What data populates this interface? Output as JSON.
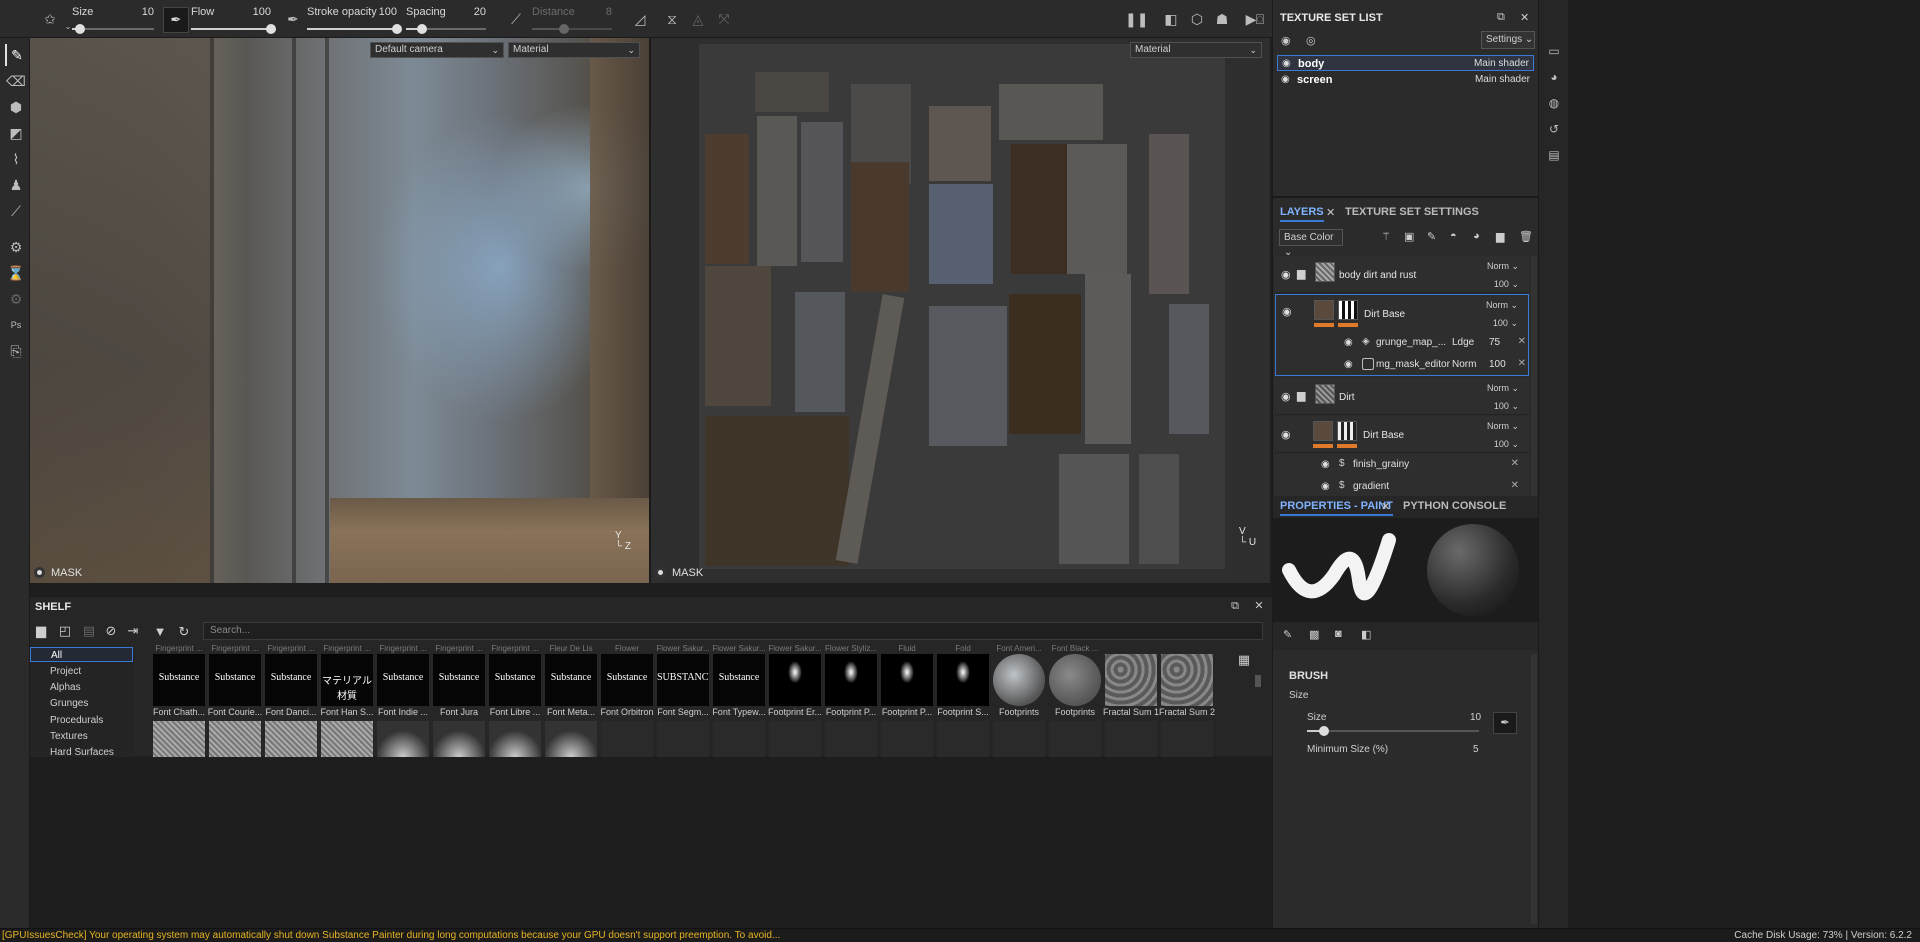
{
  "toolbar": {
    "size": {
      "label": "Size",
      "value": "10",
      "fraction": 0.1
    },
    "flow": {
      "label": "Flow",
      "value": "100",
      "fraction": 1.0
    },
    "stroke_opacity": {
      "label": "Stroke opacity",
      "value": "100",
      "fraction": 1.0
    },
    "spacing": {
      "label": "Spacing",
      "value": "20",
      "fraction": 0.2
    },
    "distance": {
      "label": "Distance",
      "value": "8",
      "fraction": 0.4
    }
  },
  "viewport_3d": {
    "camera": "Default camera",
    "channel": "Material",
    "mask_label": "MASK"
  },
  "viewport_uv": {
    "channel": "Material",
    "mask_label": "MASK"
  },
  "texture_set_list": {
    "title": "TEXTURE SET LIST",
    "settings_label": "Settings",
    "items": [
      {
        "name": "body",
        "shader": "Main shader"
      },
      {
        "name": "screen",
        "shader": "Main shader"
      }
    ]
  },
  "layers_panel": {
    "tabs": [
      "LAYERS",
      "TEXTURE SET SETTINGS"
    ],
    "channel": "Base Color",
    "layers": [
      {
        "name": "body dirt and rust",
        "blend": "Norm",
        "opacity": "100"
      },
      {
        "name": "Dirt Base",
        "blend": "Norm",
        "opacity": "100"
      },
      {
        "name": "Dirt",
        "blend": "Norm",
        "opacity": "100"
      },
      {
        "name": "Dirt Base",
        "blend": "Norm",
        "opacity": "100"
      }
    ],
    "sub_layers": [
      {
        "name": "grunge_map_...",
        "blend": "Ldge",
        "opacity": "75"
      },
      {
        "name": "mg_mask_editor",
        "blend": "Norm",
        "opacity": "100"
      }
    ],
    "effects": [
      {
        "name": "finish_grainy"
      },
      {
        "name": "gradient"
      }
    ]
  },
  "properties": {
    "tabs": [
      "PROPERTIES - PAINT",
      "PYTHON CONSOLE"
    ],
    "section": "BRUSH",
    "size_group": "Size",
    "size_label": "Size",
    "size_value": "10",
    "min_size_label": "Minimum Size (%)",
    "min_size_value": "5"
  },
  "shelf": {
    "title": "SHELF",
    "search_placeholder": "Search...",
    "categories": [
      "All",
      "Project",
      "Alphas",
      "Grunges",
      "Procedurals",
      "Textures",
      "Hard Surfaces"
    ],
    "top_row_labels": [
      "Fingerprint ...",
      "Fingerprint ...",
      "Fingerprint ...",
      "Fingerprint ...",
      "Fingerprint ...",
      "Fingerprint ...",
      "Fingerprint ...",
      "Fleur De Lis",
      "Flower",
      "Flower Sakur...",
      "Flower Sakur...",
      "Flower Sakur...",
      "Flower Styliz...",
      "Fluid",
      "Fold",
      "Font Ameri...",
      "Font Black ..."
    ],
    "items": [
      {
        "label": "Font Chath...",
        "text": "Substance"
      },
      {
        "label": "Font Courie...",
        "text": "Substance"
      },
      {
        "label": "Font Danci...",
        "text": "Substance"
      },
      {
        "label": "Font Han S...",
        "text": "マテリアル 材質"
      },
      {
        "label": "Font Indie ...",
        "text": "Substance"
      },
      {
        "label": "Font Jura",
        "text": "Substance"
      },
      {
        "label": "Font Libre ...",
        "text": "Substance"
      },
      {
        "label": "Font Meta...",
        "text": "Substance"
      },
      {
        "label": "Font Orbitron",
        "text": "Substance"
      },
      {
        "label": "Font Segm...",
        "text": "SUBSTANCE"
      },
      {
        "label": "Font Typew...",
        "text": "Substance"
      },
      {
        "label": "Footprint Er...",
        "text": ""
      },
      {
        "label": "Footprint P...",
        "text": ""
      },
      {
        "label": "Footprint P...",
        "text": ""
      },
      {
        "label": "Footprint S...",
        "text": ""
      },
      {
        "label": "Footprints",
        "text": ""
      },
      {
        "label": "Footprints",
        "text": ""
      },
      {
        "label": "Fractal Sum 1",
        "text": ""
      },
      {
        "label": "Fractal Sum 2",
        "text": ""
      }
    ]
  },
  "status": {
    "warning": "[GPUIssuesCheck] Your operating system may automatically shut down Substance Painter during long computations because your GPU doesn't support preemption. To avoid...",
    "cache": "Cache Disk Usage:",
    "cache_value": "73%",
    "version": "Version: 6.2.2"
  }
}
